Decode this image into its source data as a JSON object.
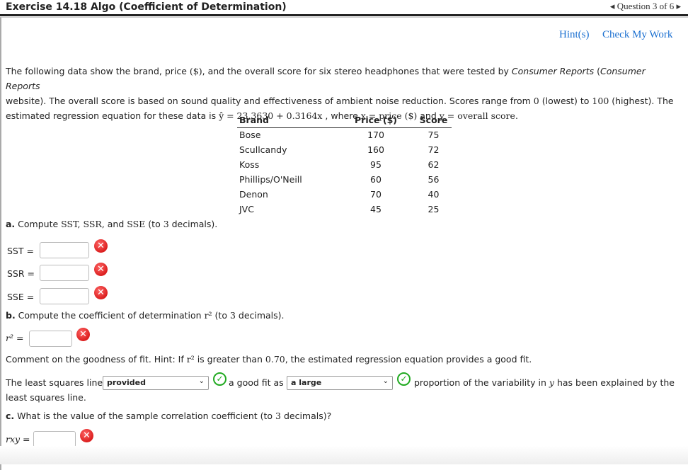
{
  "header": {
    "title": "Exercise 14.18 Algo (Coefficient of Determination)",
    "question_nav": "Question 3 of 6"
  },
  "links": {
    "hint": "Hint(s)",
    "check": "Check My Work"
  },
  "intro": {
    "l1a": "The following data show the brand, price ",
    "l1m": "($)",
    "l1b": ", and the overall score for six stereo headphones that were tested by ",
    "l1i": "Consumer Reports",
    "l1c": " (",
    "l1i2": "Consumer Reports",
    "l2a": "website). The overall score is based on sound quality and effectiveness of ambient noise reduction. Scores range from ",
    "l2m1": "0",
    "l2b": " (lowest) to ",
    "l2m2": "100",
    "l2c": " (highest). The",
    "l3a": "estimated regression equation for these data is ",
    "l3m": "ŷ = 23.3630 + 0.3164x",
    "l3b": " , where ",
    "l3m2": "x = price ($)",
    "l3c": " and ",
    "l3m3": "y = overall score",
    "l3d": "."
  },
  "table": {
    "headers": [
      "Brand",
      "Price ($)",
      "Score"
    ],
    "rows": [
      [
        "Bose",
        "170",
        "75"
      ],
      [
        "Scullcandy",
        "160",
        "72"
      ],
      [
        "Koss",
        "95",
        "62"
      ],
      [
        "Phillips/O'Neill",
        "60",
        "56"
      ],
      [
        "Denon",
        "70",
        "40"
      ],
      [
        "JVC",
        "45",
        "25"
      ]
    ]
  },
  "part_a": {
    "prefix": "a.",
    "text1": " Compute ",
    "m": "SST, SSR,",
    "text2": " and ",
    "m2": "SSE",
    "text3": " (to ",
    "m3": "3",
    "text4": " decimals).",
    "labels": [
      "SST =",
      "SSR =",
      "SSE ="
    ],
    "values": [
      "",
      "",
      ""
    ]
  },
  "part_b": {
    "prefix": "b.",
    "text1": " Compute the coefficient of determination ",
    "m": "r²",
    "text2": " (to ",
    "m2": "3",
    "text3": " decimals).",
    "label": "r² =",
    "value": "",
    "comment1": "Comment on the goodness of fit. Hint: If ",
    "comment_m": "r²",
    "comment2": " is greater than ",
    "comment_m2": "0.70",
    "comment3": ", the estimated regression equation provides a good fit.",
    "s1": "The least squares line",
    "dd1": "provided",
    "s2": "a good fit as",
    "dd2": "a large",
    "s3": "proportion of the variability in ",
    "s3m": "y",
    "s3b": " has been explained by the",
    "s4": "least squares line."
  },
  "part_c": {
    "prefix": "c.",
    "text": " What is the value of the sample correlation coefficient (to ",
    "m": "3",
    "text2": " decimals)?",
    "label": "rxy =",
    "value": ""
  },
  "icons": {
    "incorrect": "x-circle-icon",
    "correct": "check-circle-icon"
  }
}
